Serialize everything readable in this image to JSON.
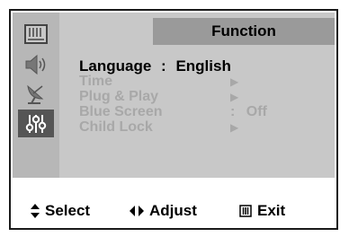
{
  "header": {
    "title": "Function"
  },
  "sidebar": {
    "items": [
      {
        "icon": "picture-icon",
        "active": false
      },
      {
        "icon": "speaker-icon",
        "active": false
      },
      {
        "icon": "satellite-dish-icon",
        "active": false
      },
      {
        "icon": "function-sliders-icon",
        "active": true
      }
    ]
  },
  "menu": {
    "items": [
      {
        "label": "Language",
        "separator": ":",
        "value": "English"
      },
      {
        "label": "Time",
        "arrow": "▶"
      },
      {
        "label": "Plug & Play",
        "arrow": "▶"
      },
      {
        "label": "Blue Screen",
        "separator": ":",
        "value": "Off"
      },
      {
        "label": "Child Lock",
        "arrow": "▶"
      }
    ]
  },
  "footer": {
    "select": {
      "glyph": "▲▼",
      "label": "Select"
    },
    "adjust": {
      "glyph": "◀▶",
      "label": "Adjust"
    },
    "exit": {
      "glyph": "Ⅲ",
      "label": "Exit"
    }
  },
  "colors": {
    "panel": "#c8c8c8",
    "sidebar": "#b7b7b7",
    "header": "#9a9a9a",
    "active_icon_bg": "#555555",
    "dim_text": "#a8a8a8"
  }
}
